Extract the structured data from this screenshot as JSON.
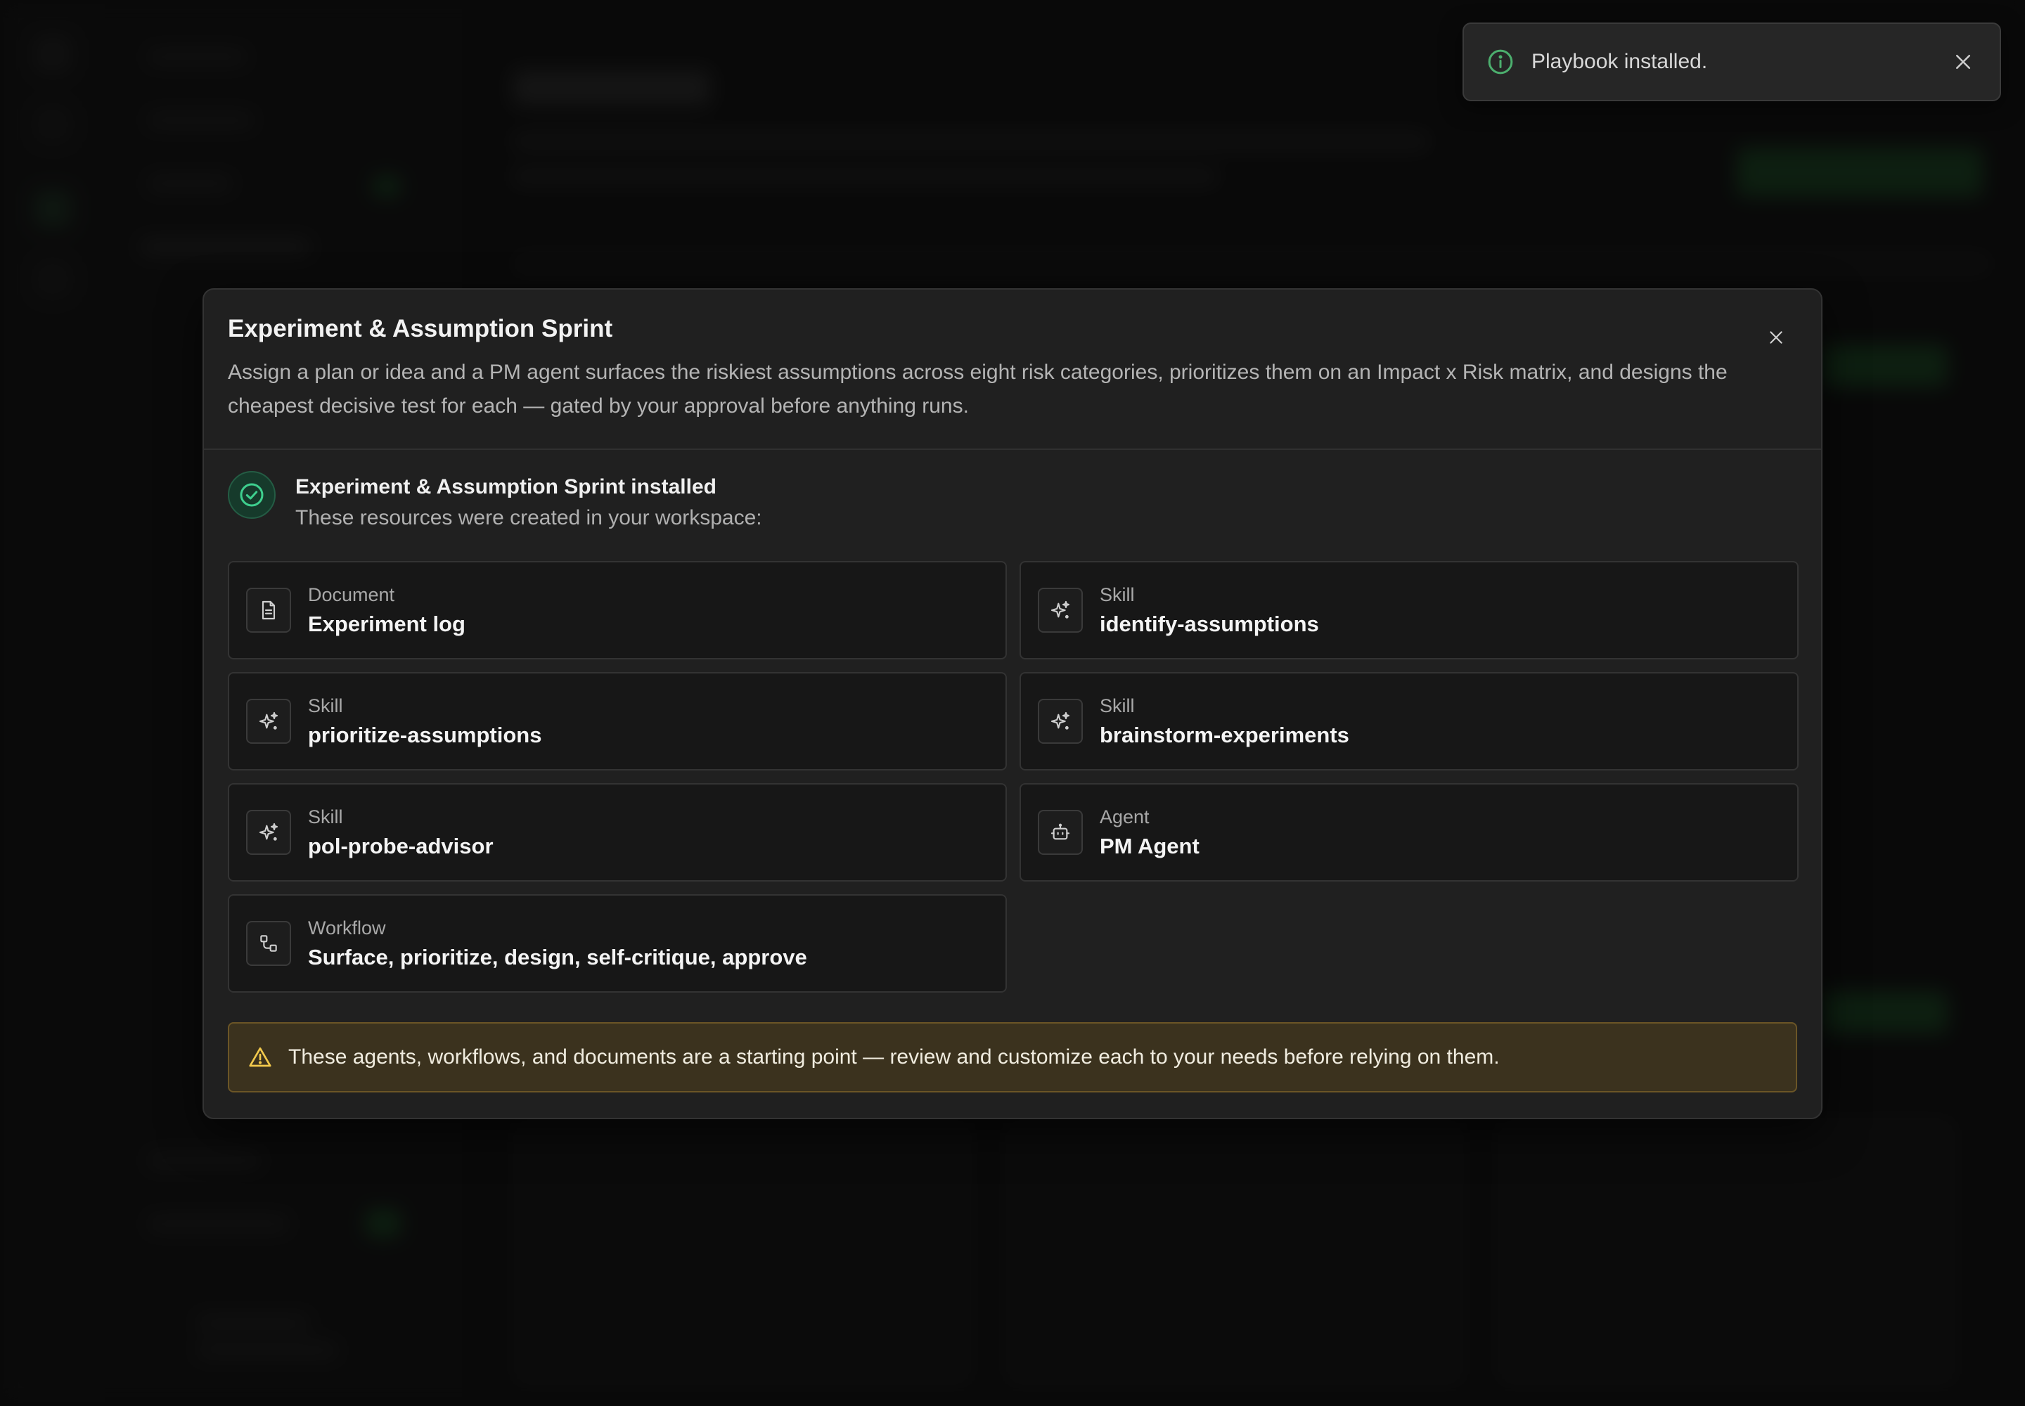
{
  "toast": {
    "message": "Playbook installed."
  },
  "modal": {
    "title": "Experiment & Assumption Sprint",
    "description": "Assign a plan or idea and a PM agent surfaces the riskiest assumptions across eight risk categories, prioritizes them on an Impact x Risk matrix, and designs the cheapest decisive test for each — gated by your approval before anything runs.",
    "success_title": "Experiment & Assumption Sprint installed",
    "success_subtitle": "These resources were created in your workspace:",
    "resources": [
      {
        "type": "Document",
        "name": "Experiment log",
        "icon": "document-icon"
      },
      {
        "type": "Skill",
        "name": "identify-assumptions",
        "icon": "sparkle-icon"
      },
      {
        "type": "Skill",
        "name": "prioritize-assumptions",
        "icon": "sparkle-icon"
      },
      {
        "type": "Skill",
        "name": "brainstorm-experiments",
        "icon": "sparkle-icon"
      },
      {
        "type": "Skill",
        "name": "pol-probe-advisor",
        "icon": "sparkle-icon"
      },
      {
        "type": "Agent",
        "name": "PM Agent",
        "icon": "bot-icon"
      },
      {
        "type": "Workflow",
        "name": "Surface, prioritize, design, self-critique, approve",
        "icon": "workflow-icon"
      }
    ],
    "warning": "These agents, workflows, and documents are a starting point — review and customize each to your needs before relying on them."
  },
  "colors": {
    "success_green": "#3ecf8e",
    "warning_amber": "#f2c94c",
    "info_green": "#4caf6e"
  }
}
